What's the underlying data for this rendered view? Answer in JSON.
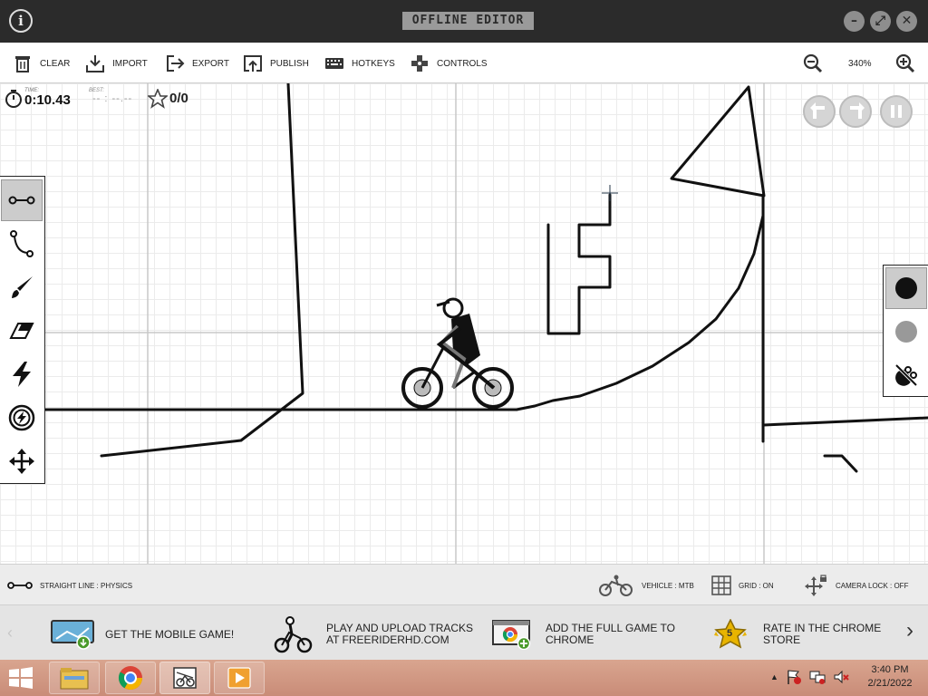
{
  "window": {
    "title": "OFFLINE EDITOR",
    "info_icon": "info-icon",
    "buttons": [
      "minimize-icon",
      "maximize-icon",
      "close-icon"
    ]
  },
  "toolbar": {
    "clear": "CLEAR",
    "import": "IMPORT",
    "export": "EXPORT",
    "publish": "PUBLISH",
    "hotkeys": "HOTKEYS",
    "controls": "CONTROLS",
    "zoom": "340%"
  },
  "stats": {
    "time_label": "TIME:",
    "time": "0:10.43",
    "best_label": "BEST:",
    "best": "-- : --.--",
    "stars": "0/0"
  },
  "tools": [
    "straight-line-tool",
    "curve-tool",
    "brush-tool",
    "eraser-tool",
    "boost-tool",
    "powerup-tool",
    "move-tool"
  ],
  "line_types": {
    "physics_color": "#111111",
    "scenery_color": "#999999"
  },
  "status": {
    "line_type": "STRAIGHT LINE : PHYSICS",
    "vehicle": "VEHICLE : MTB",
    "grid": "GRID : ON",
    "camera_lock": "CAMERA LOCK : OFF"
  },
  "promos": [
    {
      "text1": "GET THE MOBILE GAME!",
      "text2": ""
    },
    {
      "text1": "PLAY AND UPLOAD TRACKS",
      "text2": "AT FREERIDERHD.COM"
    },
    {
      "text1": "ADD THE FULL GAME TO",
      "text2": "CHROME"
    },
    {
      "text1": "RATE IN THE CHROME",
      "text2": "STORE"
    }
  ],
  "rating_badge": "5",
  "taskbar": {
    "time": "3:40 PM",
    "date": "2/21/2022"
  }
}
